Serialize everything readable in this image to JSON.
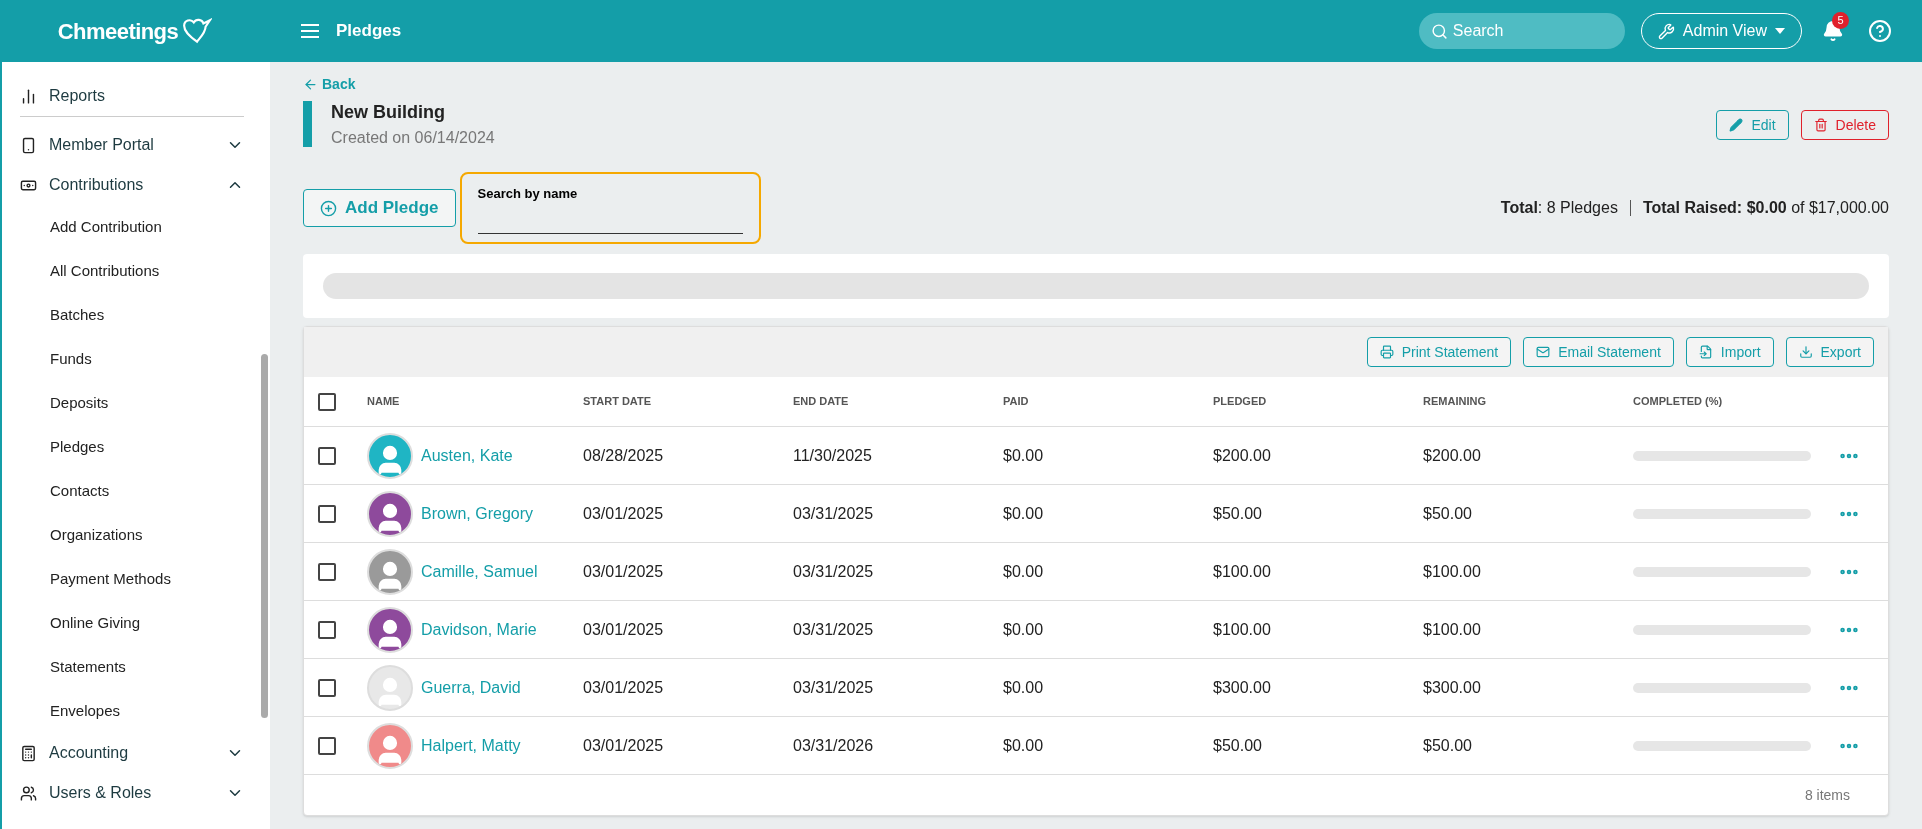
{
  "header": {
    "logo": "Chmeetings",
    "title": "Pledges",
    "search": {
      "placeholder": "Search"
    },
    "view_button": "Admin View",
    "notifications": "5"
  },
  "sidebar": {
    "items": [
      {
        "label": "Reports"
      },
      {
        "label": "Member Portal",
        "expanded": false
      },
      {
        "label": "Contributions",
        "expanded": true,
        "children": [
          {
            "label": "Add Contribution"
          },
          {
            "label": "All Contributions"
          },
          {
            "label": "Batches"
          },
          {
            "label": "Funds"
          },
          {
            "label": "Deposits"
          },
          {
            "label": "Pledges"
          },
          {
            "label": "Contacts"
          },
          {
            "label": "Organizations"
          },
          {
            "label": "Payment Methods"
          },
          {
            "label": "Online Giving"
          },
          {
            "label": "Statements"
          },
          {
            "label": "Envelopes"
          }
        ]
      },
      {
        "label": "Accounting",
        "expanded": false
      },
      {
        "label": "Users & Roles",
        "expanded": false
      }
    ]
  },
  "page": {
    "back": "Back",
    "title": "New Building",
    "subtitle": "Created on 06/14/2024",
    "edit": "Edit",
    "delete": "Delete",
    "add_pledge": "Add Pledge",
    "name_search": {
      "label": "Search by name"
    },
    "summary": "**Total**: 8 Pledges",
    "summary_2": "**Total Raised:** **$0.00** of $17,000.00"
  },
  "toolbar": [
    "Print Statement",
    "Email Statement",
    "Import",
    "Export"
  ],
  "table": {
    "select_all": {
      "checked": false
    },
    "columns": [
      "NAME",
      "START DATE",
      "END DATE",
      "PAID",
      "PLEDGED",
      "REMAINING",
      "COMPLETED (%)"
    ],
    "rows": [
      {
        "checked": false,
        "name": "Austen, Kate",
        "start": "08/28/2025",
        "end": "11/30/2025",
        "paid": "$0.00",
        "pledged": "$200.00",
        "remaining": "$200.00",
        "level": 0,
        "color": "#1fb5c4"
      },
      {
        "checked": false,
        "name": "Brown, Gregory",
        "start": "03/01/2025",
        "end": "03/31/2025",
        "paid": "$0.00",
        "pledged": "$50.00",
        "remaining": "$50.00",
        "level": 0,
        "color": "#8e4a9c"
      },
      {
        "checked": false,
        "name": "Camille, Samuel",
        "start": "03/01/2025",
        "end": "03/31/2025",
        "paid": "$0.00",
        "pledged": "$100.00",
        "remaining": "$100.00",
        "level": 0,
        "color": "#9a9a9a"
      },
      {
        "checked": false,
        "name": "Davidson, Marie",
        "start": "03/01/2025",
        "end": "03/31/2025",
        "paid": "$0.00",
        "pledged": "$100.00",
        "remaining": "$100.00",
        "level": 0,
        "color": "#8e4a9c"
      },
      {
        "checked": false,
        "name": "Guerra, David",
        "start": "03/01/2025",
        "end": "03/31/2025",
        "paid": "$0.00",
        "pledged": "$300.00",
        "remaining": "$300.00",
        "level": 0,
        "color": "#e8e8e8"
      },
      {
        "checked": false,
        "name": "Halpert, Matty",
        "start": "03/01/2025",
        "end": "03/31/2026",
        "paid": "$0.00",
        "pledged": "$50.00",
        "remaining": "$50.00",
        "level": 0,
        "color": "#f08a8a"
      }
    ],
    "footer": "8 items"
  }
}
